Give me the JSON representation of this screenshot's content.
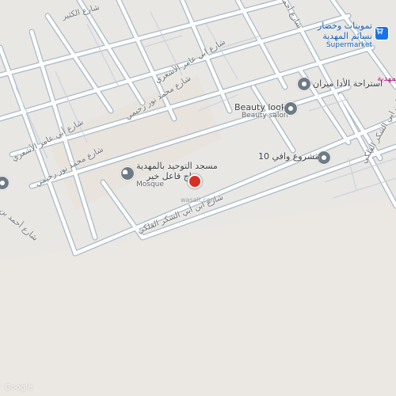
{
  "colors": {
    "land": "#e9e7e4",
    "block": "#eceae7",
    "road": "#ffffff",
    "road_edge": "#a9b9c6",
    "poi_gray": "#6e7b86",
    "poi_blue": "#1a73e8",
    "accent_pink": "#b3147a",
    "marker_red": "#d93025"
  },
  "roads": [
    {
      "label": "شارع الكثير"
    },
    {
      "label": "شارع ابي عامر الأشعري"
    },
    {
      "label": "شارع محمد نور رحيمي"
    },
    {
      "label": "شارع أبي عامر الأشعري"
    },
    {
      "label": "شارع محمد نور رحيمي"
    },
    {
      "label": "شارع أحمد بن"
    },
    {
      "label": "شارع ابن أبي الشكر الفلكي"
    },
    {
      "label": "شارع ابن ابي الشكر الفلكي"
    },
    {
      "label": "شارع أحمد"
    }
  ],
  "places": {
    "supermarket": {
      "name_line1": "تموينات وخضار",
      "name_line2": "نسائم المهدية",
      "category": "Supermarket",
      "icon": "cart-icon"
    },
    "rest_house": {
      "name": "استراحة الأدا ميران",
      "icon": "place-pin-icon"
    },
    "beauty": {
      "name": "Beauty look",
      "category": "Beauty salon",
      "icon": "place-pin-icon"
    },
    "project": {
      "name": "مشروع وافي 10",
      "icon": "place-pin-icon"
    },
    "mosque": {
      "name_line1": "مسجد التوحيد بالمهدية",
      "name_line2": "ساج فاعل خير",
      "category": "Mosque",
      "icon": "mosque-icon"
    },
    "district": {
      "name": "المهدية"
    },
    "current": {
      "label": "wasalt.com",
      "icon": "location-marker-icon"
    }
  },
  "watermark": "Google"
}
